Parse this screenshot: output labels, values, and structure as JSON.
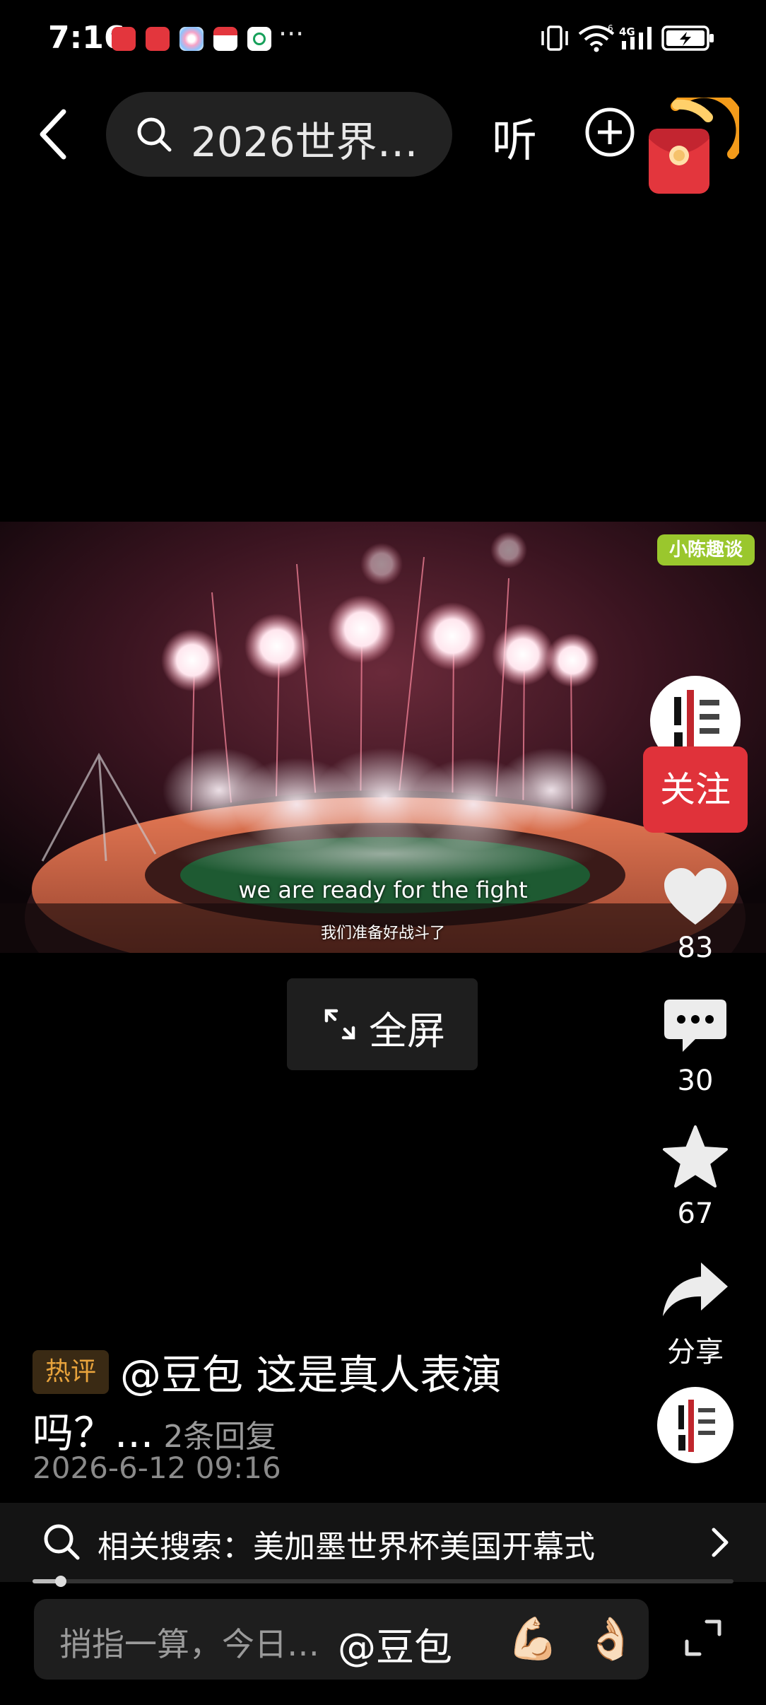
{
  "status_bar": {
    "time": "7:16",
    "more": "···",
    "app_icons": [
      "huawei-icon",
      "huawei-icon",
      "gallery-icon",
      "store-icon",
      "mobile-icon"
    ],
    "signal": "4G",
    "sim": "6"
  },
  "top_bar": {
    "search_query": "2026世界…",
    "listen_label": "听"
  },
  "video": {
    "subtitle_en": "we are ready for the fight",
    "subtitle_zh": "我们准备好战斗了",
    "watermark": "小陈趣谈",
    "fullscreen_label": "全屏"
  },
  "rail": {
    "follow_label": "关注",
    "likes": "83",
    "comments": "30",
    "favorites": "67",
    "share_label": "分享"
  },
  "comment": {
    "badge": "热评",
    "line1": "@豆包 这是真人表演",
    "line2": "吗？...",
    "replies": "2条回复",
    "date": "2026-6-12 09:16"
  },
  "related": {
    "text": "相关搜索：美加墨世界杯美国开幕式"
  },
  "progress": {
    "fraction": 0.04
  },
  "input": {
    "placeholder": "捎指一算，今日…",
    "mention": "@豆包",
    "emoji1": "💪🏻",
    "emoji2": "👌🏻"
  },
  "colors": {
    "follow": "#e0323a",
    "hot_badge_text": "#e8a33c",
    "watermark": "#9ac72d"
  }
}
